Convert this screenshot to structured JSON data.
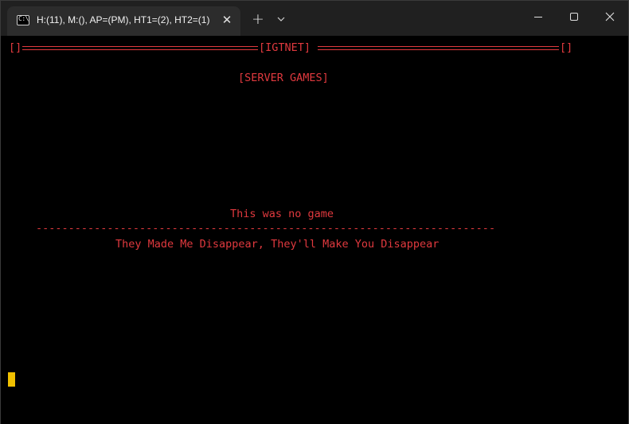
{
  "window": {
    "tab_title": "H:(11), M:(), AP=(PM), HT1=(2), HT2=(1)",
    "tab_icon_glyph": "C:\\",
    "close_tab_glyph": "✕",
    "new_tab_glyph": "+"
  },
  "terminal": {
    "header_left": "[]",
    "header_title": "[IGTNET]",
    "header_right": "[]",
    "section": "[SERVER GAMES]",
    "message_line1": "This was no game",
    "separator": "-----------------------------------------------------------------------",
    "message_line2": "They Made Me Disappear, They'll Make You Disappear",
    "text_color": "#e0393e",
    "cursor_color": "#f0c000"
  }
}
